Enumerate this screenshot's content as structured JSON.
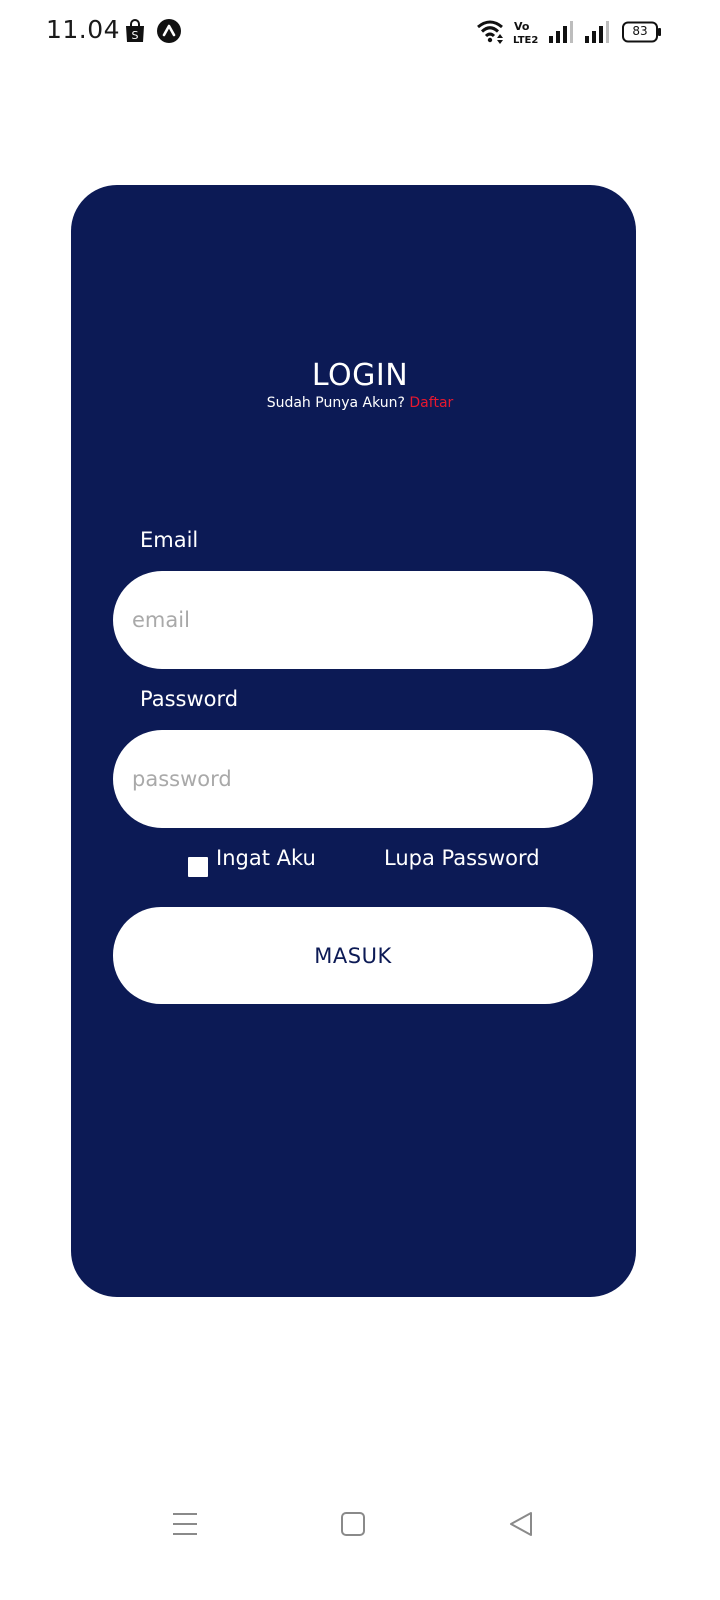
{
  "status_bar": {
    "time": "11.04",
    "battery_level": "83",
    "icons": [
      "shopee-app-icon",
      "app-a-icon",
      "wifi-icon",
      "volte-icon",
      "signal-1-icon",
      "signal-2-icon",
      "battery-icon"
    ]
  },
  "login": {
    "title": "LOGIN",
    "subtitle_text": "Sudah Punya Akun?",
    "register_link": "Daftar",
    "email_label": "Email",
    "email_placeholder": "email",
    "password_label": "Password",
    "password_placeholder": "password",
    "remember_label": "Ingat Aku",
    "forgot_label": "Lupa Password",
    "submit_label": "MASUK"
  },
  "nav_bar": {
    "icons": [
      "menu-icon",
      "home-icon",
      "back-icon"
    ]
  },
  "colors": {
    "card_background": "#0c1a55",
    "link_accent": "#e8182f",
    "input_background": "#ffffff",
    "placeholder": "#a9a9a9"
  }
}
